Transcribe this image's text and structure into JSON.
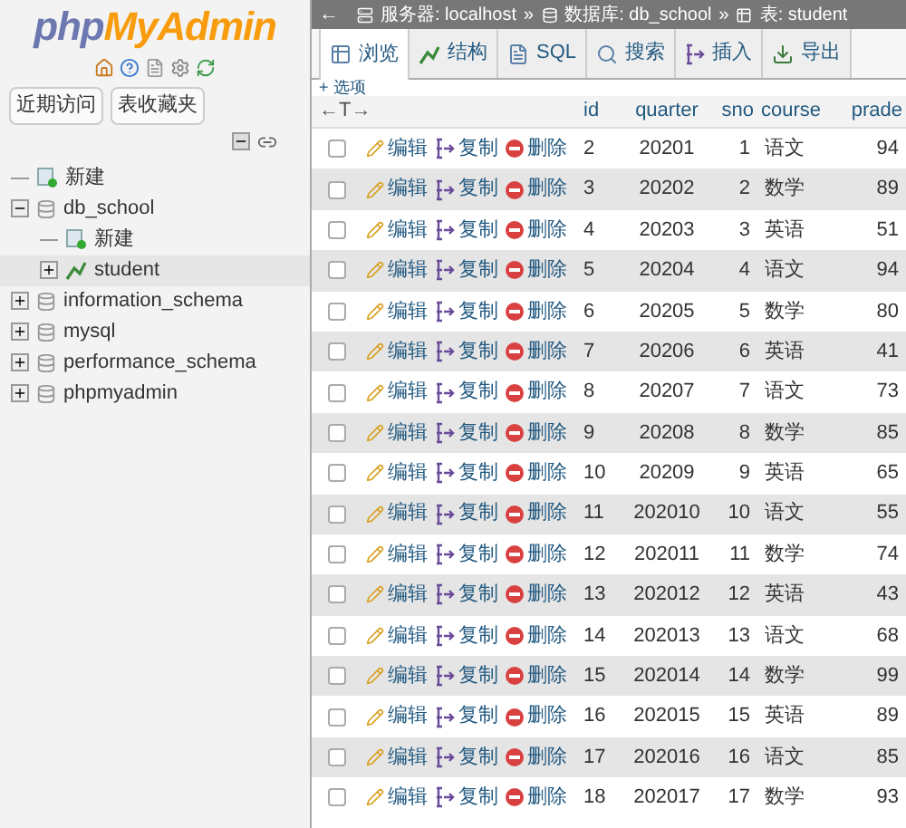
{
  "logo": {
    "part1": "php",
    "part2": "MyAdmin"
  },
  "sidebar": {
    "buttons": [
      "近期访问",
      "表收藏夹"
    ],
    "tree": [
      {
        "label": "新建",
        "kind": "new",
        "selected": false
      },
      {
        "label": "db_school",
        "kind": "database",
        "expanded": true,
        "selected": false,
        "children": [
          {
            "label": "新建",
            "kind": "new",
            "selected": false
          },
          {
            "label": "student",
            "kind": "table",
            "expanded": false,
            "selected": true
          }
        ]
      },
      {
        "label": "information_schema",
        "kind": "database",
        "expanded": false,
        "selected": false
      },
      {
        "label": "mysql",
        "kind": "database",
        "expanded": false,
        "selected": false
      },
      {
        "label": "performance_schema",
        "kind": "database",
        "expanded": false,
        "selected": false
      },
      {
        "label": "phpmyadmin",
        "kind": "database",
        "expanded": false,
        "selected": false
      }
    ]
  },
  "breadcrumb": {
    "back": "←",
    "items": [
      {
        "kind": "server",
        "text": "服务器: localhost"
      },
      {
        "kind": "database",
        "text": "数据库: db_school"
      },
      {
        "kind": "table",
        "text": "表: student"
      }
    ],
    "separator": "»"
  },
  "tabs": [
    {
      "label": "浏览",
      "kind": "browse",
      "selected": true
    },
    {
      "label": "结构",
      "kind": "structure",
      "selected": false
    },
    {
      "label": "SQL",
      "kind": "sql",
      "selected": false
    },
    {
      "label": "搜索",
      "kind": "search",
      "selected": false
    },
    {
      "label": "插入",
      "kind": "insert",
      "selected": false
    },
    {
      "label": "导出",
      "kind": "export",
      "selected": false
    }
  ],
  "options_link": "+ 选项",
  "table": {
    "resize_handle": "←T→",
    "columns": [
      "id",
      "quarter",
      "sno",
      "course",
      "prade"
    ],
    "rows": [
      {
        "checked": false,
        "actions": [
          "编辑",
          "复制",
          "删除"
        ],
        "cells": [
          "2",
          "20201",
          "1",
          "语文",
          "94"
        ]
      },
      {
        "checked": false,
        "actions": [
          "编辑",
          "复制",
          "删除"
        ],
        "cells": [
          "3",
          "20202",
          "2",
          "数学",
          "89"
        ]
      },
      {
        "checked": false,
        "actions": [
          "编辑",
          "复制",
          "删除"
        ],
        "cells": [
          "4",
          "20203",
          "3",
          "英语",
          "51"
        ]
      },
      {
        "checked": false,
        "actions": [
          "编辑",
          "复制",
          "删除"
        ],
        "cells": [
          "5",
          "20204",
          "4",
          "语文",
          "94"
        ]
      },
      {
        "checked": false,
        "actions": [
          "编辑",
          "复制",
          "删除"
        ],
        "cells": [
          "6",
          "20205",
          "5",
          "数学",
          "80"
        ]
      },
      {
        "checked": false,
        "actions": [
          "编辑",
          "复制",
          "删除"
        ],
        "cells": [
          "7",
          "20206",
          "6",
          "英语",
          "41"
        ]
      },
      {
        "checked": false,
        "actions": [
          "编辑",
          "复制",
          "删除"
        ],
        "cells": [
          "8",
          "20207",
          "7",
          "语文",
          "73"
        ]
      },
      {
        "checked": false,
        "actions": [
          "编辑",
          "复制",
          "删除"
        ],
        "cells": [
          "9",
          "20208",
          "8",
          "数学",
          "85"
        ]
      },
      {
        "checked": false,
        "actions": [
          "编辑",
          "复制",
          "删除"
        ],
        "cells": [
          "10",
          "20209",
          "9",
          "英语",
          "65"
        ]
      },
      {
        "checked": false,
        "actions": [
          "编辑",
          "复制",
          "删除"
        ],
        "cells": [
          "11",
          "202010",
          "10",
          "语文",
          "55"
        ]
      },
      {
        "checked": false,
        "actions": [
          "编辑",
          "复制",
          "删除"
        ],
        "cells": [
          "12",
          "202011",
          "11",
          "数学",
          "74"
        ]
      },
      {
        "checked": false,
        "actions": [
          "编辑",
          "复制",
          "删除"
        ],
        "cells": [
          "13",
          "202012",
          "12",
          "英语",
          "43"
        ]
      },
      {
        "checked": false,
        "actions": [
          "编辑",
          "复制",
          "删除"
        ],
        "cells": [
          "14",
          "202013",
          "13",
          "语文",
          "68"
        ]
      },
      {
        "checked": false,
        "actions": [
          "编辑",
          "复制",
          "删除"
        ],
        "cells": [
          "15",
          "202014",
          "14",
          "数学",
          "99"
        ]
      },
      {
        "checked": false,
        "actions": [
          "编辑",
          "复制",
          "删除"
        ],
        "cells": [
          "16",
          "202015",
          "15",
          "英语",
          "89"
        ]
      },
      {
        "checked": false,
        "actions": [
          "编辑",
          "复制",
          "删除"
        ],
        "cells": [
          "17",
          "202016",
          "16",
          "语文",
          "85"
        ]
      },
      {
        "checked": false,
        "actions": [
          "编辑",
          "复制",
          "删除"
        ],
        "cells": [
          "18",
          "202017",
          "17",
          "数学",
          "93"
        ]
      }
    ]
  }
}
